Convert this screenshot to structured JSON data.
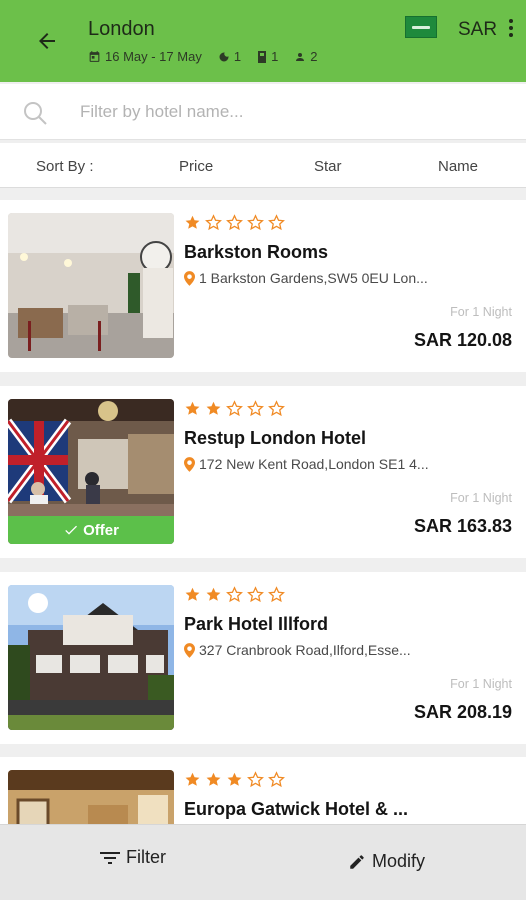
{
  "header": {
    "city": "London",
    "dates": "16 May - 17 May",
    "nights": "1",
    "rooms": "1",
    "guests": "2",
    "currency": "SAR",
    "bg_color": "#6cc04a"
  },
  "search": {
    "placeholder": "Filter by hotel name..."
  },
  "sort": {
    "label": "Sort By :",
    "options": [
      "Price",
      "Star",
      "Name"
    ]
  },
  "hotels": [
    {
      "name": "Barkston Rooms",
      "stars": 1,
      "address": "1 Barkston Gardens,SW5 0EU Lon...",
      "per_night": "For 1 Night",
      "price": "SAR 120.08",
      "offer": ""
    },
    {
      "name": "Restup London Hotel",
      "stars": 2,
      "address": "172 New Kent Road,London SE1 4...",
      "per_night": "For 1 Night",
      "price": "SAR 163.83",
      "offer": "Offer"
    },
    {
      "name": "Park Hotel Illford",
      "stars": 2,
      "address": "327 Cranbrook Road,Ilford,Esse...",
      "per_night": "For 1 Night",
      "price": "SAR 208.19",
      "offer": ""
    },
    {
      "name": "Europa Gatwick Hotel & ...",
      "stars": 3,
      "address": "",
      "per_night": "",
      "price": "",
      "offer": ""
    }
  ],
  "bottom": {
    "filter_label": "Filter",
    "modify_label": "Modify"
  },
  "colors": {
    "accent": "#6cc04a",
    "star": "#f08a24",
    "offer": "#5cc04a"
  },
  "icons": {
    "back": "arrow-left-icon",
    "calendar": "calendar-icon",
    "night": "moon-icon",
    "room": "door-icon",
    "guest": "person-icon",
    "search": "search-icon",
    "location": "location-pin-icon",
    "filter": "filter-icon",
    "modify": "pencil-icon"
  }
}
